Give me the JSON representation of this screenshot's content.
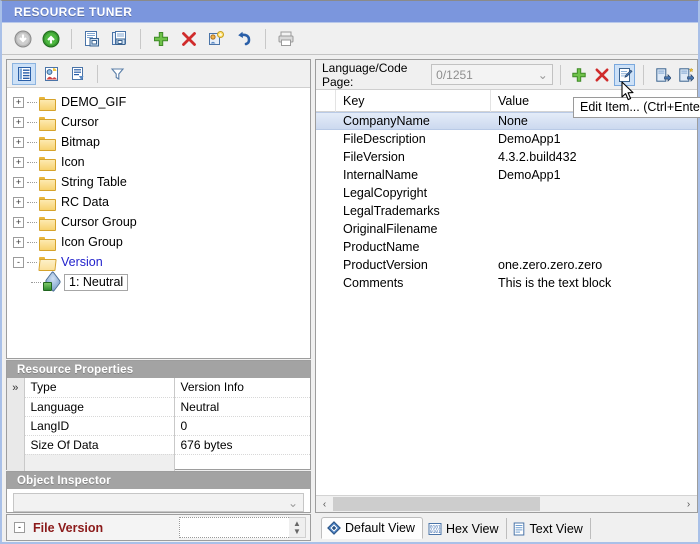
{
  "window": {
    "title": "RESOURCE TUNER",
    "title_bar_color": "#7b96dd"
  },
  "main_toolbar": {
    "buttons": [
      {
        "name": "open-file",
        "icon": "down-arrow-circle-gray-icon",
        "label": "Open"
      },
      {
        "name": "save-file",
        "icon": "up-arrow-circle-green-icon",
        "label": "Save"
      },
      {
        "name": "copy-resource",
        "icon": "copy-document-icon",
        "label": "Copy"
      },
      {
        "name": "duplicate-resource",
        "icon": "duplicate-documents-icon",
        "label": "Duplicate"
      },
      {
        "name": "add-resource",
        "icon": "green-plus-icon",
        "label": "Add Resource"
      },
      {
        "name": "delete-resource",
        "icon": "red-x-icon",
        "label": "Delete Resource"
      },
      {
        "name": "edit-resource",
        "icon": "edit-properties-icon",
        "label": "Edit"
      },
      {
        "name": "undo",
        "icon": "blue-undo-arrow-icon",
        "label": "Undo"
      },
      {
        "name": "print",
        "icon": "printer-icon",
        "label": "Print"
      }
    ]
  },
  "tree_panel": {
    "toolbar": [
      {
        "name": "resource-list-view",
        "icon": "list-view-icon",
        "active": true
      },
      {
        "name": "image-preview",
        "icon": "image-preview-icon",
        "active": false
      },
      {
        "name": "report-view",
        "icon": "report-view-icon",
        "active": false
      },
      {
        "name": "filter",
        "icon": "funnel-filter-icon",
        "active": false
      }
    ],
    "items": [
      {
        "label": "DEMO_GIF",
        "expander": "+",
        "selected": false
      },
      {
        "label": "Cursor",
        "expander": "+",
        "selected": false
      },
      {
        "label": "Bitmap",
        "expander": "+",
        "selected": false
      },
      {
        "label": "Icon",
        "expander": "+",
        "selected": false
      },
      {
        "label": "String Table",
        "expander": "+",
        "selected": false
      },
      {
        "label": "RC Data",
        "expander": "+",
        "selected": false
      },
      {
        "label": "Cursor Group",
        "expander": "+",
        "selected": false
      },
      {
        "label": "Icon Group",
        "expander": "+",
        "selected": false
      },
      {
        "label": "Version",
        "expander": "-",
        "selected": true
      }
    ],
    "child_item": {
      "label": "1: Neutral"
    }
  },
  "resource_properties": {
    "header": "Resource Properties",
    "gutter_marker": "»",
    "rows": [
      {
        "key": "Type",
        "value": "Version Info"
      },
      {
        "key": "Language",
        "value": "Neutral"
      },
      {
        "key": "LangID",
        "value": "0"
      },
      {
        "key": "Size Of Data",
        "value": "676 bytes"
      }
    ]
  },
  "object_inspector": {
    "header": "Object Inspector",
    "combo_value": ""
  },
  "file_version_row": {
    "expander": "-",
    "label": "File Version",
    "input_value": ""
  },
  "right_panel": {
    "lang_label": "Language/Code Page:",
    "lang_value": "0/1251",
    "toolbar": [
      {
        "name": "add-item-button",
        "icon": "green-plus-icon",
        "pressed": false
      },
      {
        "name": "delete-item-button",
        "icon": "red-x-icon",
        "pressed": false
      },
      {
        "name": "edit-item-button",
        "icon": "edit-notepad-pencil-icon",
        "pressed": true
      },
      {
        "name": "import-item-button",
        "icon": "import-arrow-icon",
        "pressed": false
      },
      {
        "name": "export-item-button",
        "icon": "export-star-icon",
        "pressed": false
      }
    ],
    "columns": [
      "Key",
      "Value"
    ],
    "rows": [
      {
        "key": "CompanyName",
        "value": "None",
        "selected": true
      },
      {
        "key": "FileDescription",
        "value": "DemoApp1",
        "selected": false
      },
      {
        "key": "FileVersion",
        "value": "4.3.2.build432",
        "selected": false
      },
      {
        "key": "InternalName",
        "value": "DemoApp1",
        "selected": false
      },
      {
        "key": "LegalCopyright",
        "value": "",
        "selected": false
      },
      {
        "key": "LegalTrademarks",
        "value": "",
        "selected": false
      },
      {
        "key": "OriginalFilename",
        "value": "",
        "selected": false
      },
      {
        "key": "ProductName",
        "value": "",
        "selected": false
      },
      {
        "key": "ProductVersion",
        "value": "one.zero.zero.zero",
        "selected": false
      },
      {
        "key": "Comments",
        "value": "This is the text block",
        "selected": false
      }
    ],
    "hscroll": {
      "left_arrow": "‹",
      "right_arrow": "›"
    }
  },
  "tooltip": {
    "text": "Edit Item... (Ctrl+Enter)"
  },
  "bottom_tabs": [
    {
      "label": "Default View",
      "icon": "blue-diamond-icon",
      "active": true
    },
    {
      "label": "Hex View",
      "icon": "binary-digits-icon",
      "active": false
    },
    {
      "label": "Text View",
      "icon": "text-document-icon",
      "active": false
    }
  ]
}
